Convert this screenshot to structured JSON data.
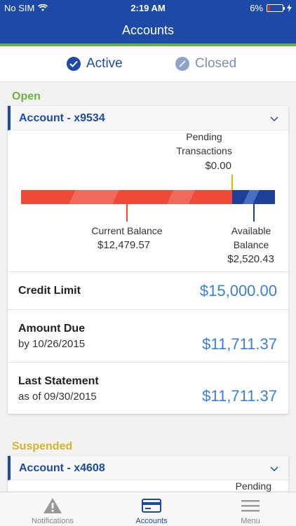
{
  "status_bar": {
    "carrier": "No SIM",
    "time": "2:19 AM",
    "battery": "6%"
  },
  "header": {
    "title": "Accounts"
  },
  "filters": {
    "active_label": "Active",
    "closed_label": "Closed"
  },
  "sections": {
    "open_label": "Open",
    "suspended_label": "Suspended"
  },
  "account_1": {
    "title": "Account - x9534",
    "pending_label_1": "Pending",
    "pending_label_2": "Transactions",
    "pending_amount": "$0.00",
    "current_label": "Current Balance",
    "current_amount": "$12,479.57",
    "available_label_1": "Available",
    "available_label_2": "Balance",
    "available_amount": "$2,520.43",
    "balance_bar": {
      "used_fraction": 0.832,
      "available_fraction": 0.168
    },
    "credit_limit_label": "Credit Limit",
    "credit_limit_value": "$15,000.00",
    "amount_due_label": "Amount Due",
    "amount_due_sub": "by 10/26/2015",
    "amount_due_value": "$11,711.37",
    "last_statement_label": "Last Statement",
    "last_statement_sub": "as of 09/30/2015",
    "last_statement_value": "$11,711.37"
  },
  "account_2": {
    "title": "Account - x4608",
    "pending_label_1": "Pending"
  },
  "tabbar": {
    "notifications": "Notifications",
    "accounts": "Accounts",
    "menu": "Menu"
  },
  "colors": {
    "brand_blue": "#1d4aa6",
    "open_green": "#6cb33f",
    "suspended_yellow": "#d4b52a",
    "balance_red": "#ee4a38",
    "value_blue": "#3a7fd6"
  }
}
